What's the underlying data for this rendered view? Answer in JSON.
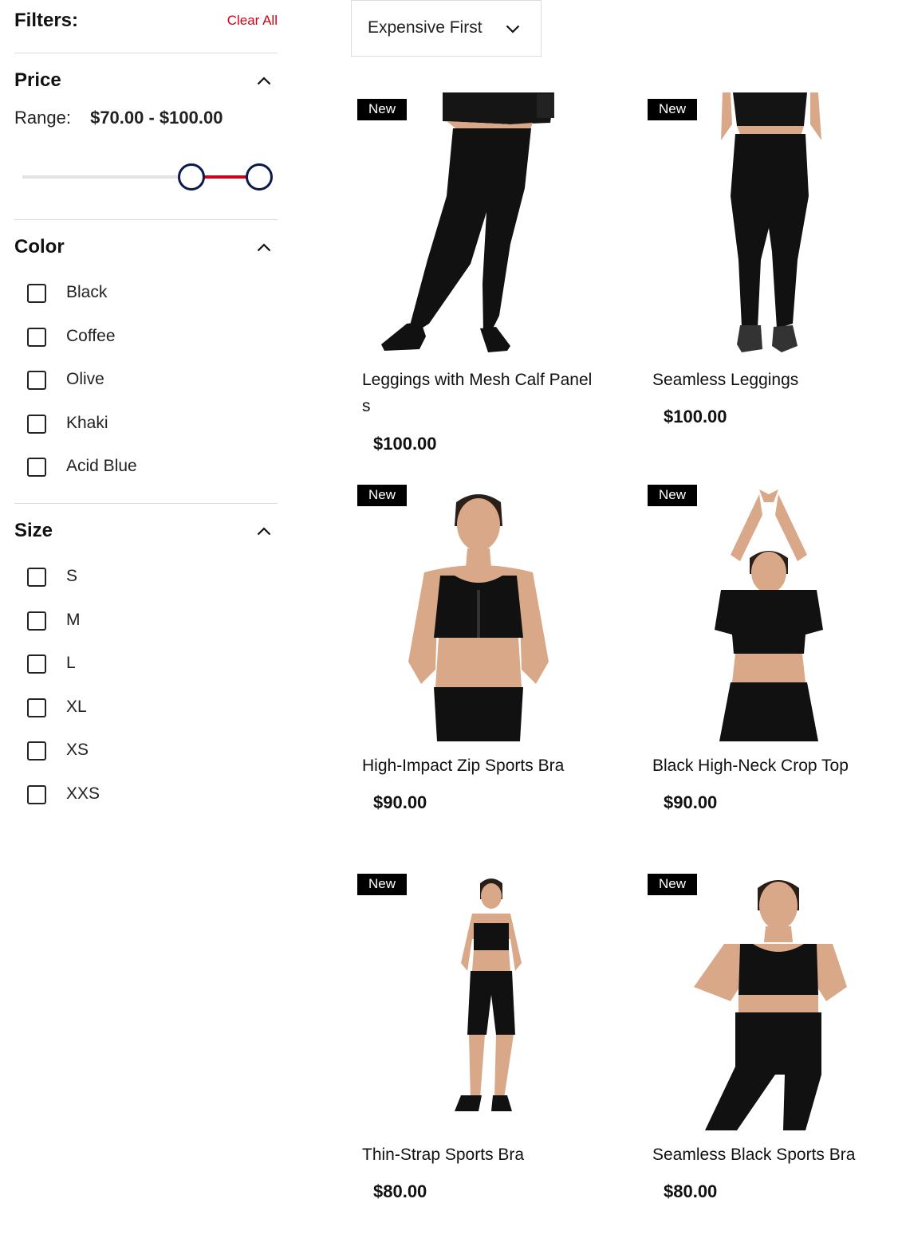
{
  "filters": {
    "title": "Filters:",
    "clear_all": "Clear All"
  },
  "price": {
    "title": "Price",
    "range_label": "Range:",
    "range_value": "$70.00 - $100.00",
    "slider_min_fraction": 0.7,
    "slider_max_fraction": 1.0
  },
  "color": {
    "title": "Color",
    "options": [
      "Black",
      "Coffee",
      "Olive",
      "Khaki",
      "Acid Blue"
    ]
  },
  "size": {
    "title": "Size",
    "options": [
      "S",
      "M",
      "L",
      "XL",
      "XS",
      "XXS"
    ]
  },
  "sort": {
    "selected": "Expensive First"
  },
  "colors": {
    "accent": "#d0021b",
    "slider_thumb_border": "#0a1a4a",
    "badge_bg": "#000000",
    "badge_text": "#ffffff"
  },
  "products": [
    {
      "badge": "New",
      "name": "Leggings with Mesh Calf Panels",
      "price": "$100.00",
      "image": "model-black-leggings-mesh-calf"
    },
    {
      "badge": "New",
      "name": "Seamless Leggings",
      "price": "$100.00",
      "image": "model-black-seamless-leggings-back"
    },
    {
      "badge": "New",
      "name": "High-Impact Zip Sports Bra",
      "price": "$90.00",
      "image": "model-zip-sports-bra"
    },
    {
      "badge": "New",
      "name": "Black High-Neck Crop Top",
      "price": "$90.00",
      "image": "model-high-neck-crop-top"
    },
    {
      "badge": "New",
      "name": "Thin-Strap Sports Bra",
      "price": "$80.00",
      "image": "model-thin-strap-sports-bra"
    },
    {
      "badge": "New",
      "name": "Seamless Black Sports Bra",
      "price": "$80.00",
      "image": "model-seamless-black-sports-bra"
    }
  ]
}
